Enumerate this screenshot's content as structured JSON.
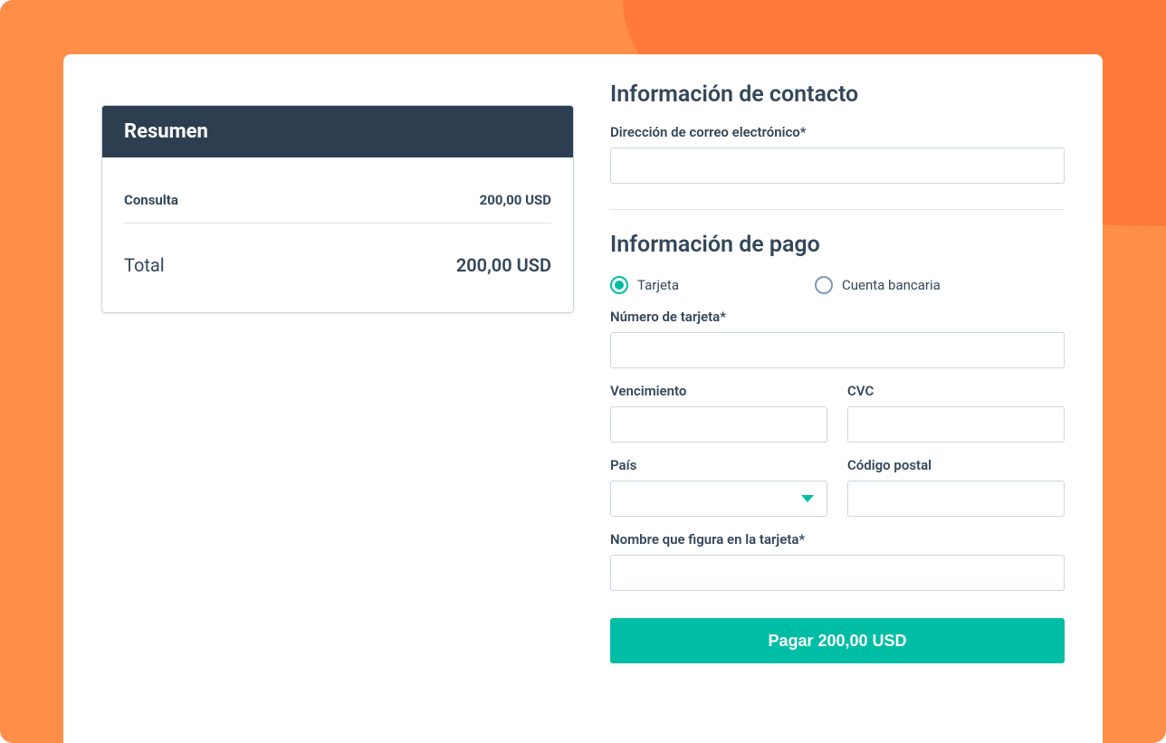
{
  "summary": {
    "header": "Resumen",
    "item_label": "Consulta",
    "item_amount": "200,00 USD",
    "total_label": "Total",
    "total_amount": "200,00 USD"
  },
  "contact": {
    "title": "Información de contacto",
    "email_label": "Dirección de correo electrónico*",
    "email_value": ""
  },
  "payment": {
    "title": "Información de pago",
    "radio_card": "Tarjeta",
    "radio_bank": "Cuenta bancaria",
    "selected_method": "card",
    "card_number_label": "Número de tarjeta*",
    "card_number_value": "",
    "expiry_label": "Vencimiento",
    "expiry_value": "",
    "cvc_label": "CVC",
    "cvc_value": "",
    "country_label": "País",
    "country_value": "",
    "postal_label": "Código postal",
    "postal_value": "",
    "name_label": "Nombre que figura en la tarjeta*",
    "name_value": ""
  },
  "button": {
    "pay_label": "Pagar 200,00 USD"
  }
}
